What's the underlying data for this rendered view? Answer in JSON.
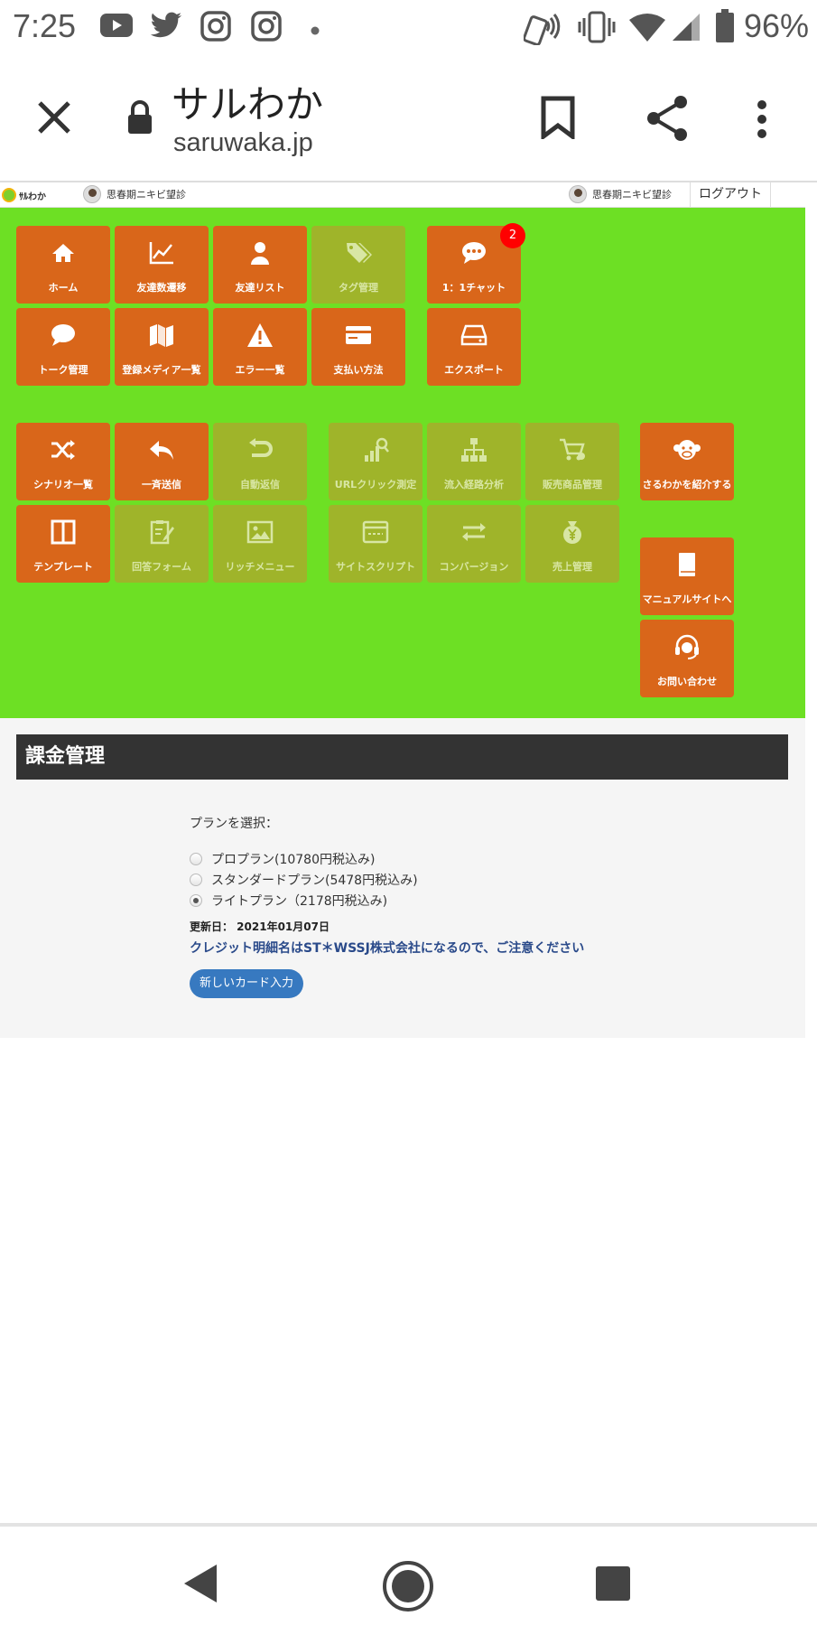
{
  "status_bar": {
    "time": "7:25",
    "battery": "96%",
    "icons": [
      "youtube-icon",
      "twitter-icon",
      "instagram-icon",
      "instagram-icon",
      "dot-icon",
      "nfc-icon",
      "vibrate-icon",
      "wifi-icon",
      "signal-icon",
      "battery-icon"
    ]
  },
  "browser": {
    "title": "サルわか",
    "url": "saruwaka.jp"
  },
  "site_header": {
    "logo_text": "ｻﾙわか",
    "user_left": "思春期ニキビ望診",
    "user_right": "思春期ニキビ望診",
    "logout": "ログアウト"
  },
  "tiles": {
    "home": "ホーム",
    "friends_trend": "友達数遷移",
    "friends_list": "友達リスト",
    "tag_manage": "タグ管理",
    "chat": "1：1チャット",
    "chat_badge": "2",
    "talk_manage": "トーク管理",
    "media_list": "登録メディア一覧",
    "error_list": "エラー一覧",
    "payment": "支払い方法",
    "export": "エクスポート",
    "scenario_list": "シナリオ一覧",
    "broadcast": "一斉送信",
    "auto_reply": "自動返信",
    "url_click": "URLクリック測定",
    "inflow": "流入経路分析",
    "sales_items": "販売商品管理",
    "introduce": "さるわかを紹介する",
    "template": "テンプレート",
    "answer_form": "回答フォーム",
    "rich_menu": "リッチメニュー",
    "site_script": "サイトスクリプト",
    "conversion": "コンバージョン",
    "sales_manage": "売上管理",
    "manual": "マニュアルサイトへ",
    "contact": "お問い合わせ"
  },
  "billing": {
    "heading": "課金管理",
    "plan_label": "プランを選択：",
    "plans": [
      {
        "label": "プロプラン(10780円税込み)",
        "checked": false
      },
      {
        "label": "スタンダードプラン(5478円税込み)",
        "checked": false
      },
      {
        "label": "ライトプラン（2178円税込み)",
        "checked": true
      }
    ],
    "updated": "更新日： 2021年01月07日",
    "notice": "クレジット明細名はST＊WSSJ株式会社になるので、ご注意ください",
    "new_card_button": "新しいカード入力"
  },
  "colors": {
    "green_panel": "#6de024",
    "tile_active": "#d9661a",
    "tile_inactive": "#9fb42a",
    "heading_bar": "#333333",
    "button_blue": "#3779c0"
  }
}
